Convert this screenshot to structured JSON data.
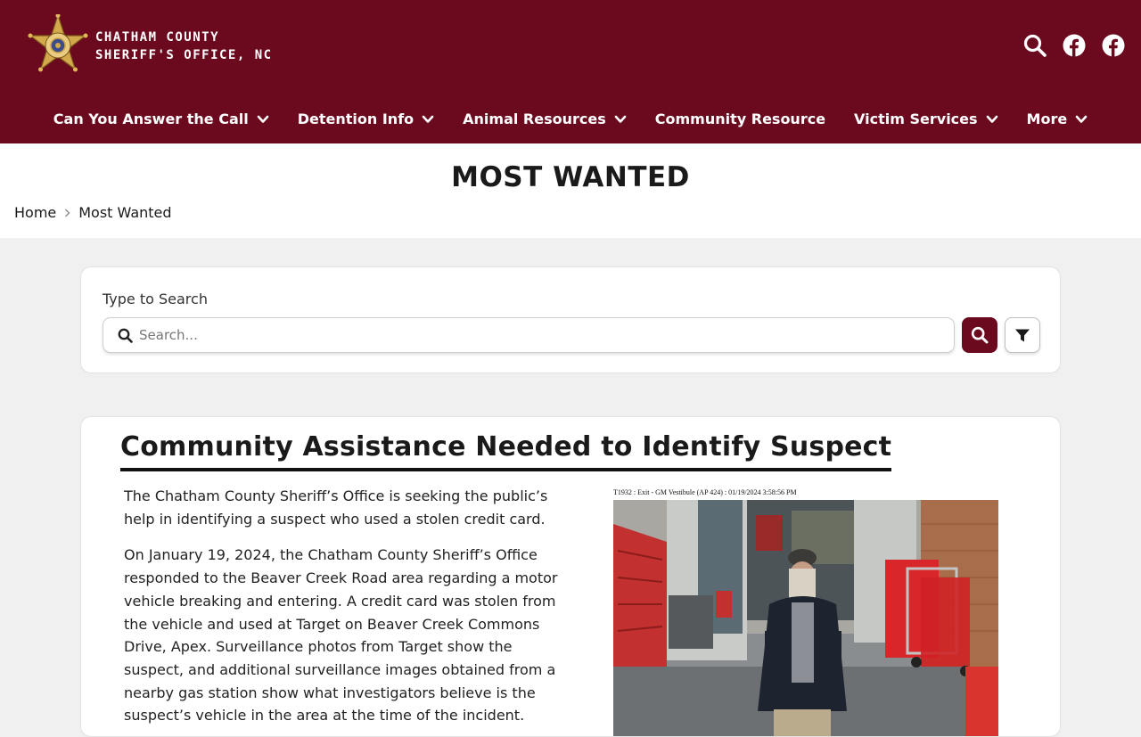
{
  "colors": {
    "brand": "#6b0a1e",
    "white": "#ffffff",
    "gold": "#c9a24a"
  },
  "site": {
    "name_line1": "CHATHAM COUNTY",
    "name_line2": "SHERIFF'S OFFICE, NC",
    "badge_text": "SHERIFF"
  },
  "header_icons": [
    "search-icon",
    "facebook-icon",
    "facebook-icon"
  ],
  "nav": {
    "items": [
      {
        "label": "Can You Answer the Call",
        "has_dropdown": true
      },
      {
        "label": "Detention Info",
        "has_dropdown": true
      },
      {
        "label": "Animal Resources",
        "has_dropdown": true
      },
      {
        "label": "Community Resource",
        "has_dropdown": false
      },
      {
        "label": "Victim Services",
        "has_dropdown": true
      },
      {
        "label": "More",
        "has_dropdown": true
      }
    ]
  },
  "page": {
    "title": "MOST WANTED",
    "breadcrumb": [
      "Home",
      "Most Wanted"
    ]
  },
  "search": {
    "label": "Type to Search",
    "placeholder": "Search...",
    "value": ""
  },
  "article": {
    "title": "Community Assistance Needed to Identify Suspect",
    "paragraphs": [
      "The Chatham County Sheriff’s Office is seeking the public’s help in identifying a suspect who used a stolen credit card.",
      "On January 19, 2024, the Chatham County Sheriff’s Office responded to the Beaver Creek Road area regarding a motor vehicle breaking and entering. A credit card was stolen from the vehicle and used at Target on Beaver Creek Commons Drive, Apex. Surveillance photos from Target show the suspect, and additional surveillance images obtained from a nearby gas station show what investigators believe is the suspect’s vehicle in the area at the time of the incident."
    ],
    "photo_caption": "T1932 : Exit - GM Vestibule (AP 424) : 01/19/2024 3:58:56 PM"
  }
}
